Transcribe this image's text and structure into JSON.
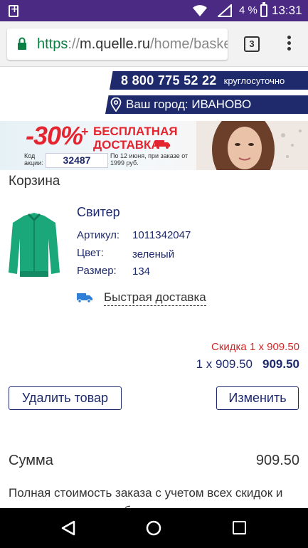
{
  "status_bar": {
    "battery_percent": "4 %",
    "time": "13:31"
  },
  "browser": {
    "url_scheme": "https",
    "url_sep": "://",
    "url_host": "m.quelle.ru",
    "url_path": "/home/basket",
    "tab_count": "3"
  },
  "header": {
    "phone": "8 800 775 52 22",
    "phone_note": "круглосуточно",
    "city": "Ваш город: ИВАНОВО"
  },
  "banner": {
    "discount": "-30%",
    "plus": "+",
    "free_line1": "БЕСПЛАТНАЯ",
    "free_line2": "ДОСТАВКА",
    "code_label": "Код акции:",
    "code": "32487",
    "conditions": "По 12 июня, при заказе от 1999 руб."
  },
  "cart": {
    "title": "Корзина",
    "product": {
      "name": "Свитер",
      "attrs": [
        {
          "label": "Артикул:",
          "value": "1011342047"
        },
        {
          "label": "Цвет:",
          "value": "зеленый"
        },
        {
          "label": "Размер:",
          "value": "134"
        }
      ],
      "delivery": "Быстрая доставка",
      "discount_line": "Скидка 1 x 909.50",
      "qty_price": "1 x 909.50",
      "total": "909.50"
    },
    "delete_button": "Удалить товар",
    "edit_button": "Изменить",
    "sum_label": "Сумма",
    "sum_value": "909.50",
    "footnote": "Полная стоимость заказа с учетом всех скидок и стоимости доставки будет рассчитана в"
  },
  "colors": {
    "status_bar": "#4a2a82",
    "brand_navy": "#1e2a6b",
    "discount_red": "#d02626",
    "product_green": "#1aa77a"
  }
}
